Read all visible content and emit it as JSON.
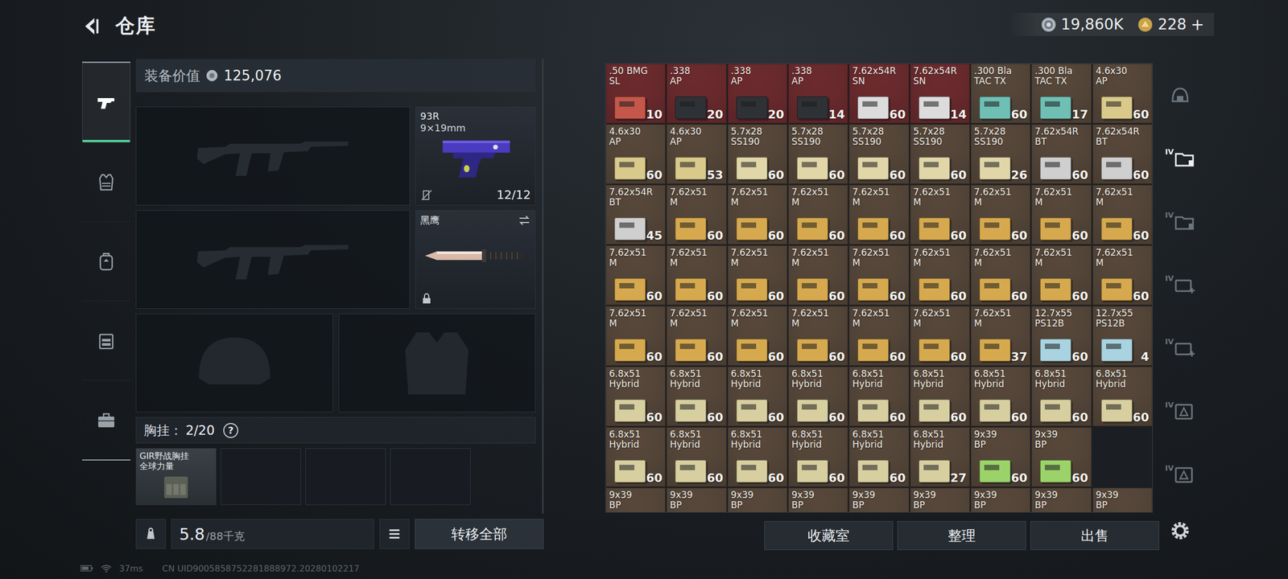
{
  "topbar": {
    "title": "仓库",
    "currency": [
      {
        "kind": "silver",
        "value": "19,860K",
        "add": ""
      },
      {
        "kind": "gold",
        "value": "228",
        "add": "+"
      }
    ]
  },
  "left_tabs": [
    {
      "kind": "weapons",
      "selected": true
    },
    {
      "kind": "armor",
      "selected": false
    },
    {
      "kind": "backpack",
      "selected": false
    },
    {
      "kind": "rig",
      "selected": false
    },
    {
      "kind": "case",
      "selected": false
    }
  ],
  "loadout": {
    "value_label": "装备价值",
    "value": "125,076",
    "primary": [
      {
        "empty": true
      },
      {
        "empty": true
      }
    ],
    "sidearm": {
      "name": "93R",
      "caliber": "9×19mm",
      "ammo": "12/12"
    },
    "melee": {
      "name": "黑鹰",
      "locked": true
    },
    "gear": [
      {
        "kind": "helmet",
        "empty": true
      },
      {
        "kind": "armor",
        "empty": true
      }
    ],
    "rig": {
      "label": "胸挂：",
      "capacity": "2/20",
      "help": "?",
      "cells": [
        {
          "name": "GIR野战胸挂",
          "sub": "全球力量",
          "filled": true
        },
        {
          "name": "",
          "sub": "",
          "filled": false
        },
        {
          "name": "",
          "sub": "",
          "filled": false
        },
        {
          "name": "",
          "sub": "",
          "filled": false
        }
      ]
    },
    "weight": "5.8",
    "weight_max": "/88千克",
    "transfer": "转移全部"
  },
  "stash": {
    "items": [
      {
        "name": ".50 BMG",
        "sub": "SL",
        "count": "10",
        "color": "#6b2b2e",
        "box": "#c4574a"
      },
      {
        "name": ".338",
        "sub": "AP",
        "count": "20",
        "color": "#6b2b2e",
        "box": "#2e3236"
      },
      {
        "name": ".338",
        "sub": "AP",
        "count": "20",
        "color": "#6b2b2e",
        "box": "#2e3236"
      },
      {
        "name": ".338",
        "sub": "AP",
        "count": "14",
        "color": "#6b2b2e",
        "box": "#2e3236"
      },
      {
        "name": "7.62x54R",
        "sub": "SN",
        "count": "60",
        "color": "#6b2b2e",
        "box": "#dcdcdc"
      },
      {
        "name": "7.62x54R",
        "sub": "SN",
        "count": "14",
        "color": "#6b2b2e",
        "box": "#dcdcdc"
      },
      {
        "name": ".300 Bla",
        "sub": "TAC TX",
        "count": "60",
        "color": "#56473a",
        "box": "#6fbfb5"
      },
      {
        "name": ".300 Bla",
        "sub": "TAC TX",
        "count": "17",
        "color": "#56473a",
        "box": "#6fbfb5"
      },
      {
        "name": "4.6x30",
        "sub": "AP",
        "count": "60",
        "color": "#56473a",
        "box": "#d9c98a"
      },
      {
        "name": "4.6x30",
        "sub": "AP",
        "count": "60",
        "color": "#56473a",
        "box": "#d9c98a"
      },
      {
        "name": "4.6x30",
        "sub": "AP",
        "count": "53",
        "color": "#56473a",
        "box": "#d9c98a"
      },
      {
        "name": "5.7x28",
        "sub": "SS190",
        "count": "60",
        "color": "#56473a",
        "box": "#e0d6a8"
      },
      {
        "name": "5.7x28",
        "sub": "SS190",
        "count": "60",
        "color": "#56473a",
        "box": "#e0d6a8"
      },
      {
        "name": "5.7x28",
        "sub": "SS190",
        "count": "60",
        "color": "#56473a",
        "box": "#e0d6a8"
      },
      {
        "name": "5.7x28",
        "sub": "SS190",
        "count": "60",
        "color": "#56473a",
        "box": "#e0d6a8"
      },
      {
        "name": "5.7x28",
        "sub": "SS190",
        "count": "26",
        "color": "#56473a",
        "box": "#e0d6a8"
      },
      {
        "name": "7.62x54R",
        "sub": "BT",
        "count": "60",
        "color": "#56473a",
        "box": "#cfcfcf"
      },
      {
        "name": "7.62x54R",
        "sub": "BT",
        "count": "60",
        "color": "#56473a",
        "box": "#cfcfcf"
      },
      {
        "name": "7.62x54R",
        "sub": "BT",
        "count": "45",
        "color": "#56473a",
        "box": "#cfcfcf"
      },
      {
        "name": "7.62x51",
        "sub": "M",
        "count": "60",
        "color": "#56473a",
        "box": "#d6a94e"
      },
      {
        "name": "7.62x51",
        "sub": "M",
        "count": "60",
        "color": "#56473a",
        "box": "#d6a94e"
      },
      {
        "name": "7.62x51",
        "sub": "M",
        "count": "60",
        "color": "#56473a",
        "box": "#d6a94e"
      },
      {
        "name": "7.62x51",
        "sub": "M",
        "count": "60",
        "color": "#56473a",
        "box": "#d6a94e"
      },
      {
        "name": "7.62x51",
        "sub": "M",
        "count": "60",
        "color": "#56473a",
        "box": "#d6a94e"
      },
      {
        "name": "7.62x51",
        "sub": "M",
        "count": "60",
        "color": "#56473a",
        "box": "#d6a94e"
      },
      {
        "name": "7.62x51",
        "sub": "M",
        "count": "60",
        "color": "#56473a",
        "box": "#d6a94e"
      },
      {
        "name": "7.62x51",
        "sub": "M",
        "count": "60",
        "color": "#56473a",
        "box": "#d6a94e"
      },
      {
        "name": "7.62x51",
        "sub": "M",
        "count": "60",
        "color": "#56473a",
        "box": "#d6a94e"
      },
      {
        "name": "7.62x51",
        "sub": "M",
        "count": "60",
        "color": "#56473a",
        "box": "#d6a94e"
      },
      {
        "name": "7.62x51",
        "sub": "M",
        "count": "60",
        "color": "#56473a",
        "box": "#d6a94e"
      },
      {
        "name": "7.62x51",
        "sub": "M",
        "count": "60",
        "color": "#56473a",
        "box": "#d6a94e"
      },
      {
        "name": "7.62x51",
        "sub": "M",
        "count": "60",
        "color": "#56473a",
        "box": "#d6a94e"
      },
      {
        "name": "7.62x51",
        "sub": "M",
        "count": "60",
        "color": "#56473a",
        "box": "#d6a94e"
      },
      {
        "name": "7.62x51",
        "sub": "M",
        "count": "60",
        "color": "#56473a",
        "box": "#d6a94e"
      },
      {
        "name": "7.62x51",
        "sub": "M",
        "count": "60",
        "color": "#56473a",
        "box": "#d6a94e"
      },
      {
        "name": "7.62x51",
        "sub": "M",
        "count": "60",
        "color": "#56473a",
        "box": "#d6a94e"
      },
      {
        "name": "7.62x51",
        "sub": "M",
        "count": "60",
        "color": "#56473a",
        "box": "#d6a94e"
      },
      {
        "name": "7.62x51",
        "sub": "M",
        "count": "60",
        "color": "#56473a",
        "box": "#d6a94e"
      },
      {
        "name": "7.62x51",
        "sub": "M",
        "count": "60",
        "color": "#56473a",
        "box": "#d6a94e"
      },
      {
        "name": "7.62x51",
        "sub": "M",
        "count": "60",
        "color": "#56473a",
        "box": "#d6a94e"
      },
      {
        "name": "7.62x51",
        "sub": "M",
        "count": "60",
        "color": "#56473a",
        "box": "#d6a94e"
      },
      {
        "name": "7.62x51",
        "sub": "M",
        "count": "60",
        "color": "#56473a",
        "box": "#d6a94e"
      },
      {
        "name": "7.62x51",
        "sub": "M",
        "count": "37",
        "color": "#56473a",
        "box": "#d6a94e"
      },
      {
        "name": "12.7x55",
        "sub": "PS12B",
        "count": "60",
        "color": "#56473a",
        "box": "#a9d3e0"
      },
      {
        "name": "12.7x55",
        "sub": "PS12B",
        "count": "4",
        "color": "#56473a",
        "box": "#a9d3e0"
      },
      {
        "name": "6.8x51",
        "sub": "Hybrid",
        "count": "60",
        "color": "#56473a",
        "box": "#d8cfa0"
      },
      {
        "name": "6.8x51",
        "sub": "Hybrid",
        "count": "60",
        "color": "#56473a",
        "box": "#d8cfa0"
      },
      {
        "name": "6.8x51",
        "sub": "Hybrid",
        "count": "60",
        "color": "#56473a",
        "box": "#d8cfa0"
      },
      {
        "name": "6.8x51",
        "sub": "Hybrid",
        "count": "60",
        "color": "#56473a",
        "box": "#d8cfa0"
      },
      {
        "name": "6.8x51",
        "sub": "Hybrid",
        "count": "60",
        "color": "#56473a",
        "box": "#d8cfa0"
      },
      {
        "name": "6.8x51",
        "sub": "Hybrid",
        "count": "60",
        "color": "#56473a",
        "box": "#d8cfa0"
      },
      {
        "name": "6.8x51",
        "sub": "Hybrid",
        "count": "60",
        "color": "#56473a",
        "box": "#d8cfa0"
      },
      {
        "name": "6.8x51",
        "sub": "Hybrid",
        "count": "60",
        "color": "#56473a",
        "box": "#d8cfa0"
      },
      {
        "name": "6.8x51",
        "sub": "Hybrid",
        "count": "60",
        "color": "#56473a",
        "box": "#d8cfa0"
      },
      {
        "name": "6.8x51",
        "sub": "Hybrid",
        "count": "60",
        "color": "#56473a",
        "box": "#d8cfa0"
      },
      {
        "name": "6.8x51",
        "sub": "Hybrid",
        "count": "60",
        "color": "#56473a",
        "box": "#d8cfa0"
      },
      {
        "name": "6.8x51",
        "sub": "Hybrid",
        "count": "60",
        "color": "#56473a",
        "box": "#d8cfa0"
      },
      {
        "name": "6.8x51",
        "sub": "Hybrid",
        "count": "60",
        "color": "#56473a",
        "box": "#d8cfa0"
      },
      {
        "name": "6.8x51",
        "sub": "Hybrid",
        "count": "60",
        "color": "#56473a",
        "box": "#d8cfa0"
      },
      {
        "name": "6.8x51",
        "sub": "Hybrid",
        "count": "27",
        "color": "#56473a",
        "box": "#d8cfa0"
      },
      {
        "name": "9x39",
        "sub": "BP",
        "count": "60",
        "color": "#56473a",
        "box": "#9bd36a"
      },
      {
        "name": "9x39",
        "sub": "BP",
        "count": "60",
        "color": "#56473a",
        "box": "#9bd36a"
      }
    ],
    "partial_row": [
      {
        "name": "9x39",
        "sub": "BP",
        "color": "#56473a",
        "box": "#9bd36a"
      },
      {
        "name": "9x39",
        "sub": "BP",
        "color": "#56473a",
        "box": "#9bd36a"
      },
      {
        "name": "9x39",
        "sub": "BP",
        "color": "#56473a",
        "box": "#9bd36a"
      },
      {
        "name": "9x39",
        "sub": "BP",
        "color": "#56473a",
        "box": "#9bd36a"
      },
      {
        "name": "9x39",
        "sub": "BP",
        "color": "#56473a",
        "box": "#9bd36a"
      },
      {
        "name": "9x39",
        "sub": "BP",
        "color": "#56473a",
        "box": "#9bd36a"
      },
      {
        "name": "9x39",
        "sub": "BP",
        "color": "#56473a",
        "box": "#9bd36a"
      },
      {
        "name": "9x39",
        "sub": "BP",
        "color": "#56473a",
        "box": "#9bd36a"
      },
      {
        "name": "9x39",
        "sub": "BP",
        "color": "#56473a",
        "box": "#9bd36a"
      }
    ],
    "buttons": [
      "收藏室",
      "整理",
      "出售"
    ]
  },
  "right_tabs": [
    {
      "kind": "safe",
      "label": "",
      "selected": false
    },
    {
      "kind": "folder",
      "label": "IV",
      "selected": true
    },
    {
      "kind": "folder",
      "label": "IV",
      "selected": false
    },
    {
      "kind": "medkit",
      "label": "IV",
      "selected": false
    },
    {
      "kind": "medkit",
      "label": "IV",
      "selected": false
    },
    {
      "kind": "triangle",
      "label": "IV",
      "selected": false
    },
    {
      "kind": "triangle",
      "label": "IV",
      "selected": false
    }
  ],
  "status_bar": {
    "ping": "37ms",
    "uid": "CN UID9005858752281888972.20280102217"
  }
}
